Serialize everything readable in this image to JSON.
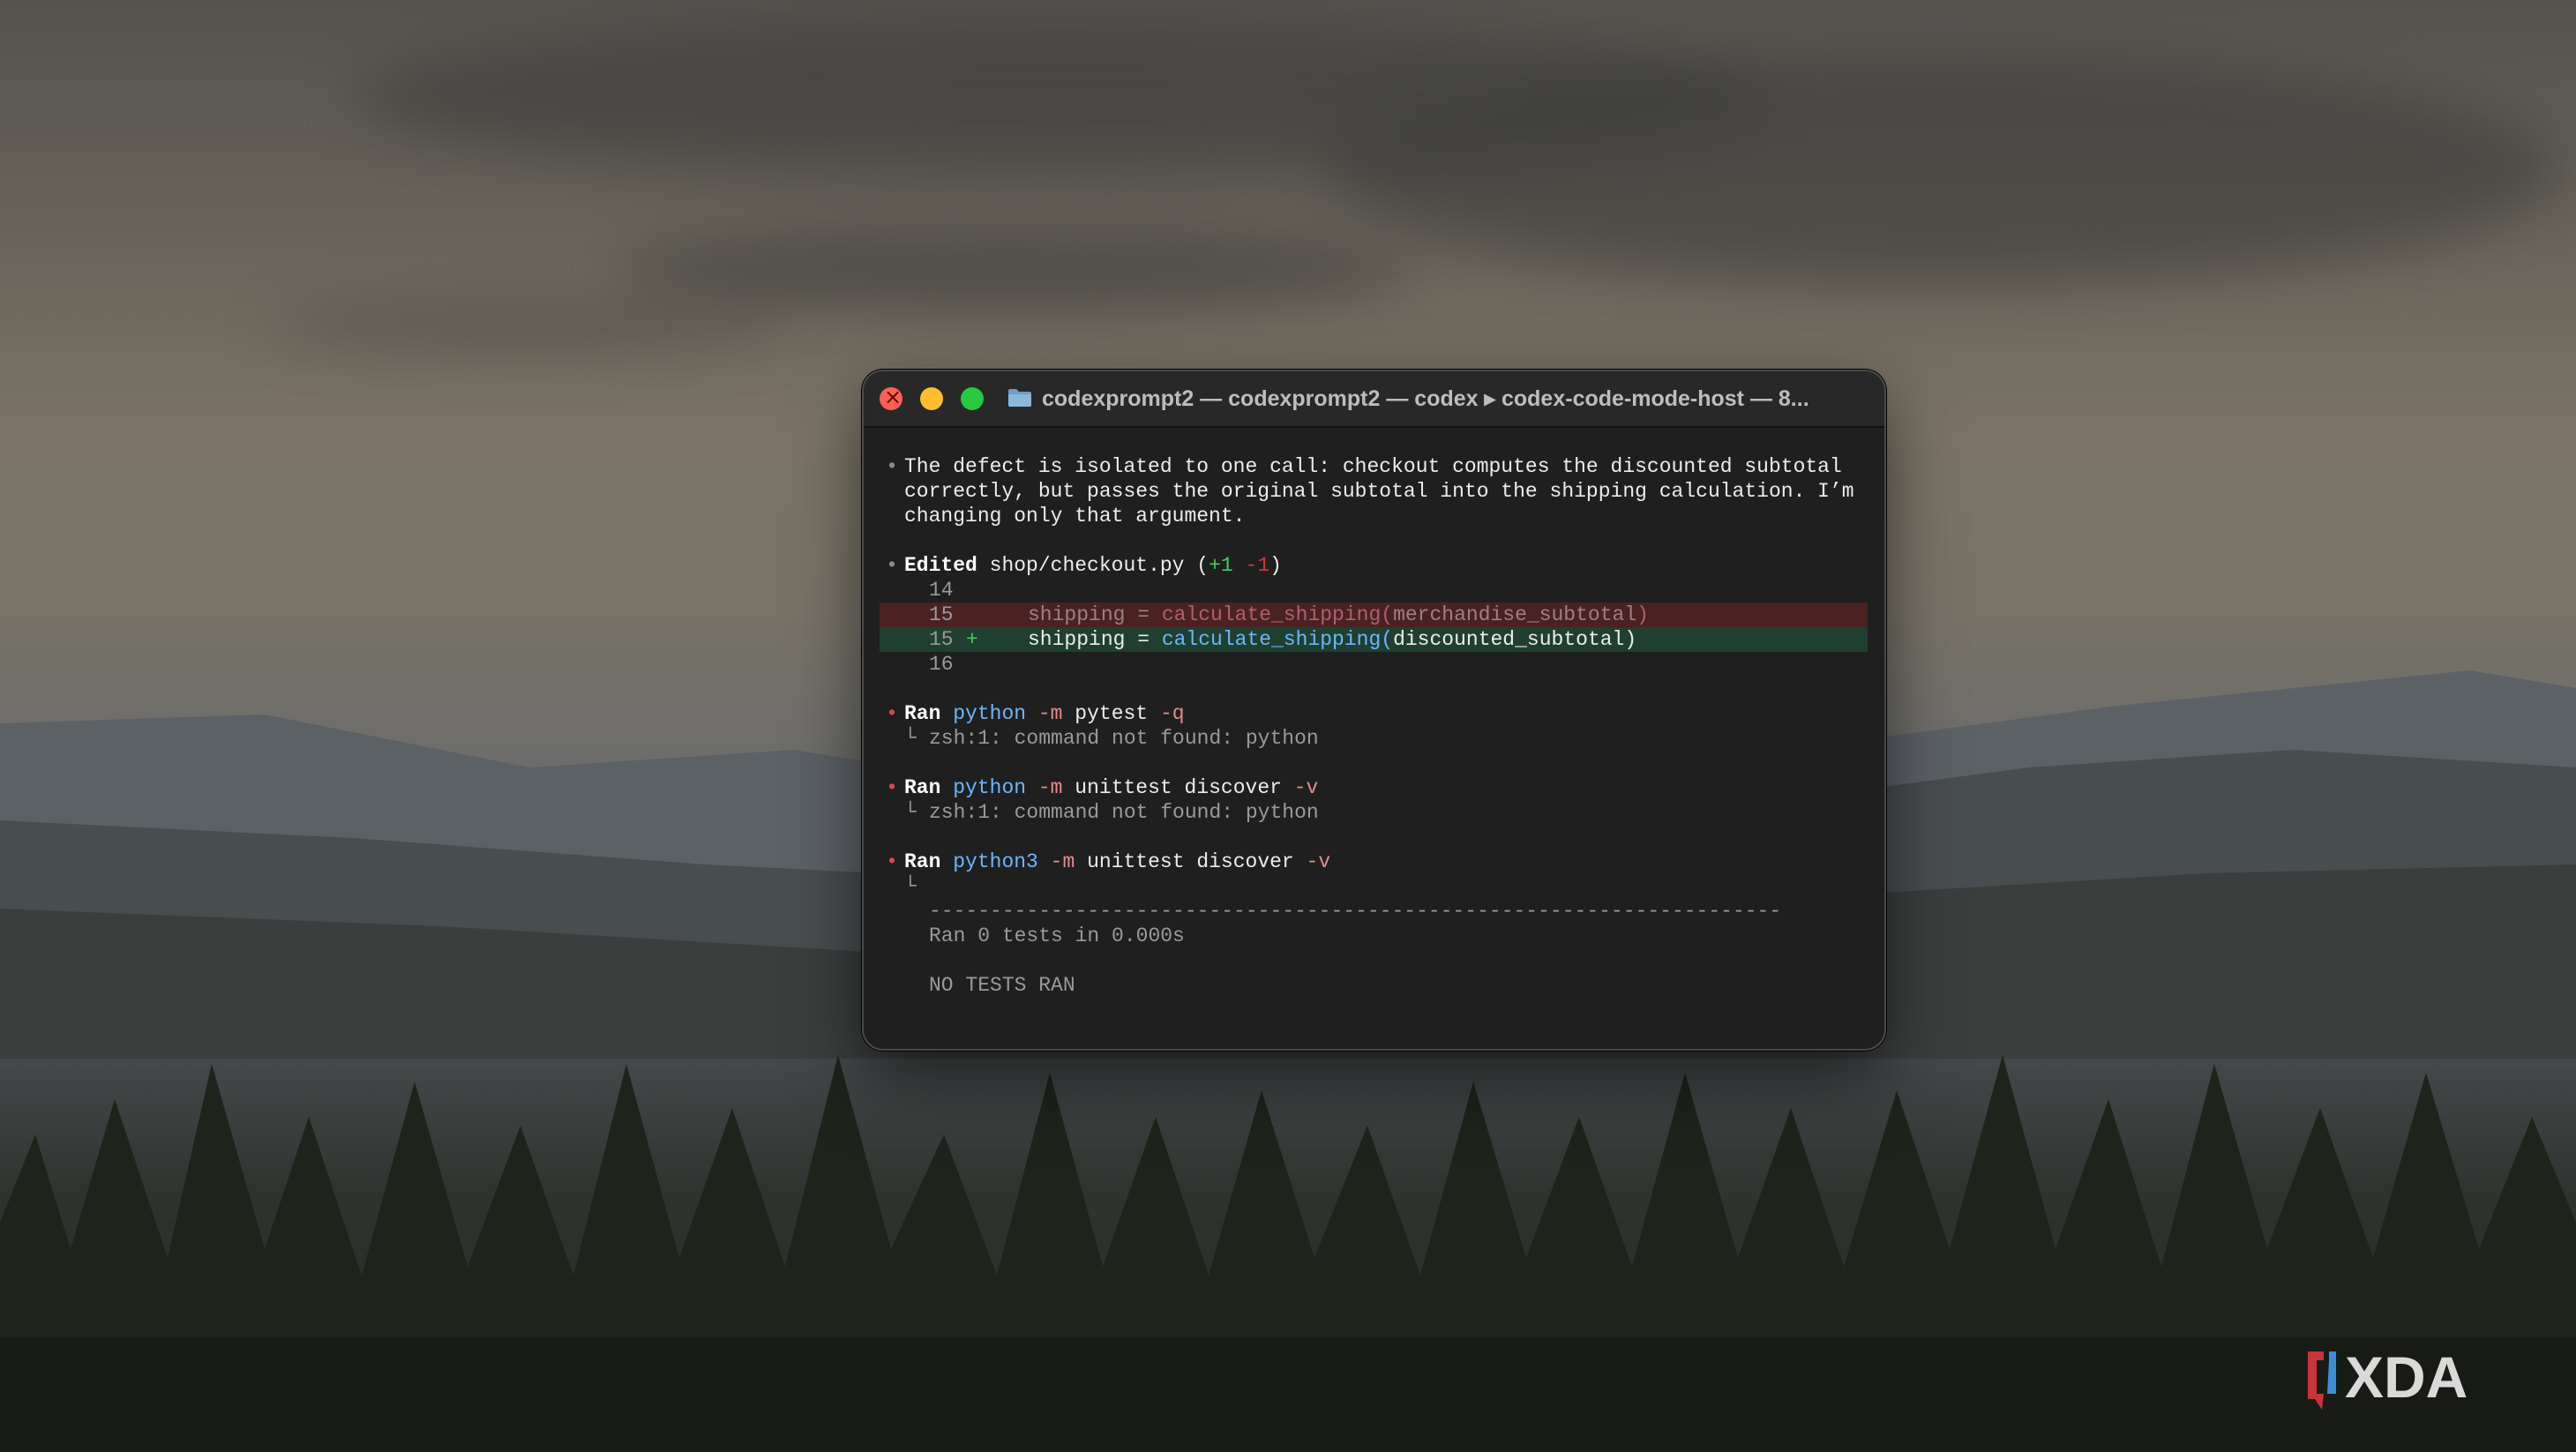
{
  "window": {
    "title": "codexprompt2 — codexprompt2 — codex ▸ codex-code-mode-host — 8..."
  },
  "transcript": {
    "message_lines": [
      "The defect is isolated to one call: checkout computes the discounted subtotal",
      "correctly, but passes the original subtotal into the shipping calculation. I’m",
      "changing only that argument."
    ],
    "edit": {
      "verb": "Edited",
      "file": "shop/checkout.py",
      "open": "(",
      "added": "+1",
      "removed": "-1",
      "close": ")",
      "diff": [
        {
          "num": "14",
          "type": "context",
          "code": ""
        },
        {
          "num": "15",
          "type": "removed",
          "mark": "",
          "lhs": "shipping = ",
          "fn": "calculate_shipping(",
          "arg": "merchandise_subtotal",
          "end": ")"
        },
        {
          "num": "15",
          "type": "added",
          "mark": "+",
          "lhs": "shipping = ",
          "fn": "calculate_shipping(",
          "arg": "discounted_subtotal",
          "end": ")"
        },
        {
          "num": "16",
          "type": "context",
          "code": ""
        }
      ]
    },
    "runs": [
      {
        "verb": "Ran",
        "bin": "python",
        "flag": "-m",
        "args": "pytest",
        "opt": "-q",
        "output": "zsh:1: command not found: python"
      },
      {
        "verb": "Ran",
        "bin": "python",
        "flag": "-m",
        "args": "unittest discover",
        "opt": "-v",
        "output": "zsh:1: command not found: python"
      },
      {
        "verb": "Ran",
        "bin": "python3",
        "flag": "-m",
        "args": "unittest discover",
        "opt": "-v",
        "output": ""
      }
    ],
    "corner_glyph": "└",
    "bullet_glyph": "•",
    "separator": "----------------------------------------------------------------------",
    "summary": "Ran 0 tests in 0.000s",
    "result": "NO TESTS RAN"
  },
  "watermark": {
    "text": "XDA"
  },
  "colors": {
    "accent_blue": "#6cb6ff",
    "added_green": "#3fd35a",
    "removed_red": "#d03a3a",
    "terminal_bg": "#1f1f1f"
  }
}
